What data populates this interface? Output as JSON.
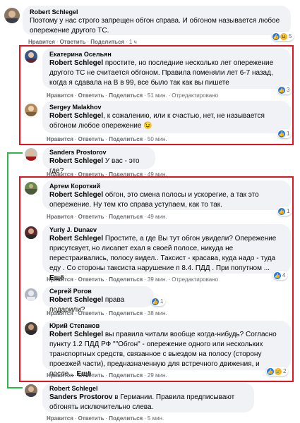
{
  "comments": [
    {
      "id": "c1",
      "author": "Robert Schlegel",
      "text": "Поэтому у нас строго запрещен обгон справа. И обгоном называется любое опережение другого ТС.",
      "actions": [
        "Нравится",
        "Ответить",
        "Поделиться"
      ],
      "time": "1 ч",
      "reaction_count": "5"
    },
    {
      "id": "c2",
      "author": "Екатерина Осельян",
      "mention": "Robert Schlegel",
      "text": " простите, но последние несколько лет опережение другого ТС не считается обгоном. Правила поменяли лет 6-7 назад, когда я сдавала на В в 99, все было так как вы пишете",
      "actions": [
        "Нравится",
        "Ответить",
        "Поделиться"
      ],
      "time": "51 мин.",
      "edited": "Отредактировано",
      "reaction_count": "3"
    },
    {
      "id": "c3",
      "author": "Sergey Malakhov",
      "mention": "Robert Schlegel",
      "text": ", к сожалению, или к счастью, нет, не называется обгоном любое опережение 😉",
      "actions": [
        "Нравится",
        "Ответить",
        "Поделиться"
      ],
      "time": "50 мин.",
      "reaction_count": "1"
    },
    {
      "id": "c4",
      "author": "Sanders Prostorov",
      "mention": "Robert Schlegel",
      "text": " У вас - это где?",
      "actions": [
        "Нравится",
        "Ответить",
        "Поделиться"
      ],
      "time": "49 мин."
    },
    {
      "id": "c5",
      "author": "Артем Короткий",
      "mention": "Robert Schlegel",
      "text": " обгон, это смена полосы и ускорегие, а так это опережение. Ну тем кто справа уступаем, как то так.",
      "actions": [
        "Нравится",
        "Ответить",
        "Поделиться"
      ],
      "time": "49 мин.",
      "reaction_count": "1"
    },
    {
      "id": "c6",
      "author": "Yuriy J. Dunaev",
      "mention": "Robert Schlegel",
      "text": " Простите, а где Вы тут обгон увидели? Опережение присутсвует, но лисапет ехал в своей полосе, никуда не перестраивались, полосу видел.. Таксист - красава, куда надо - туда еду . Со стороны таксиста нарушение п 8.4. ПДД . При попутном ...",
      "more": "Ещё",
      "actions": [
        "Нравится",
        "Ответить",
        "Поделиться"
      ],
      "time": "39 мин.",
      "edited": "Отредактировано",
      "reaction_count": "4"
    },
    {
      "id": "c7",
      "author": "Сергей Рогов",
      "mention": "Robert Schlegel",
      "text": " права подарили?",
      "actions": [
        "Нравится",
        "Ответить",
        "Поделиться"
      ],
      "time": "38 мин.",
      "reaction_count": "1"
    },
    {
      "id": "c8",
      "author": "Юрий Степанов",
      "mention": "Robert Schlegel",
      "text": " вы правила читали вообще когда-нибудь? Согласно пункту 1.2 ПДД РФ \"\"Обгон\" - опережение одного или нескольких транспортных средств, связанное с выездом на полосу (сторону проезжей части), предназначенную для встречного движения, и после...",
      "more": "Ещё",
      "actions": [
        "Нравится",
        "Ответить",
        "Поделиться"
      ],
      "time": "29 мин.",
      "reaction_count": "2"
    },
    {
      "id": "c9",
      "author": "Robert Schlegel",
      "mention": "Sanders Prostorov",
      "text": " в Германии. Правила предписывают обгонять исключительно слева.",
      "actions": [
        "Нравится",
        "Ответить",
        "Поделиться"
      ],
      "time": "5 мин."
    }
  ],
  "colors": {
    "highlight_box": "#e0141e",
    "thread_line": "#2db84d",
    "bubble_bg": "#f0f2f5",
    "like_blue": "#1877f2",
    "meta_gray": "#65676b"
  },
  "icons": {
    "like": "thumbs-up-icon",
    "haha": "laughing-face-icon"
  }
}
